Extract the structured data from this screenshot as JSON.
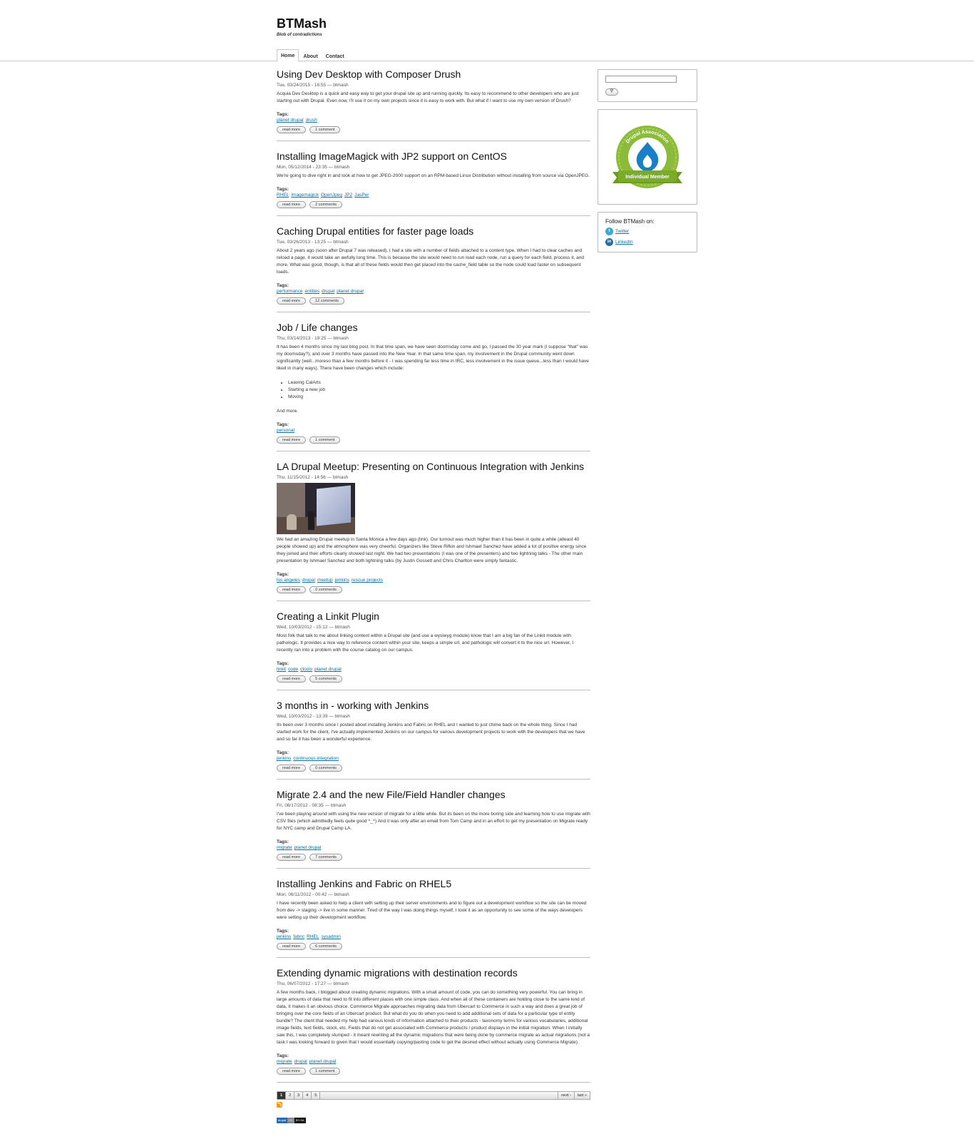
{
  "site": {
    "name": "BTMash",
    "slogan": "Blob of contradictions"
  },
  "tabs": [
    {
      "label": "Home",
      "active": true
    },
    {
      "label": "About"
    },
    {
      "label": "Contact"
    }
  ],
  "nodes": [
    {
      "title": "Using Dev Desktop with Composer Drush",
      "meta": "Tue, 03/24/2015 - 16:55 — btmash",
      "paragraphs": [
        "Acquia Dev Desktop is a quick and easy way to get your drupal site up and running quickly. Its easy to recommend to other developers who are just starting out with Drupal. Even now, I'll use it on my own projects since it is easy to work with. But what if I want to use my own version of Drush?"
      ],
      "tags_label": "Tags:",
      "tags": [
        "planet drupal",
        "drush"
      ],
      "read_more": "read more",
      "comments": "1 comment"
    },
    {
      "title": "Installing ImageMagick with JP2 support on CentOS",
      "meta": "Mon, 05/12/2014 - 23:35 — btmash",
      "paragraphs": [
        "We're going to dive right in and look at how to get JPEG-2000 support on an RPM-based Linux Distribution without installing from source via OpenJPEG."
      ],
      "tags_label": "Tags:",
      "tags": [
        "RHEL",
        "Imagemagick",
        "OpenJpeg",
        "JP2",
        "JasPer"
      ],
      "read_more": "read more",
      "comments": "2 comments"
    },
    {
      "title": "Caching Drupal entities for faster page loads",
      "meta": "Tue, 03/26/2013 - 13:25 — btmash",
      "paragraphs": [
        "About 2 years ago (soon after Drupal 7 was released), I had a site with a number of fields attached to a content type. When I had to clear caches and reload a page, it would take an awfully long time. This is because the site would need to run load each node, run a query for each field, process it, and more. What was good, though, is that all of these fields would then get placed into the cache_field table so the node could load faster on subsequent loads."
      ],
      "tags_label": "Tags:",
      "tags": [
        "performance",
        "entities",
        "drupal",
        "planet drupal"
      ],
      "read_more": "read more",
      "comments": "12 comments"
    },
    {
      "title": "Job / Life changes",
      "meta": "Thu, 03/14/2013 - 19:25 — btmash",
      "paragraphs": [
        "It has been 4 months since my last blog post. In that time span, we have seen doomsday come and go, I passed the 30 year mark (I suppose \"that\" was my doomsday?), and over 3 months have passed into the New Year. In that same time span, my involvement in the Drupal community went down significantly (well...moreso than a few months before it - I was spending far less time in IRC, less involvement in the issue queue...less than I would have liked in many ways). There have been changes which include:"
      ],
      "list": [
        "Leaving CalArts",
        "Starting a new job",
        "Moving"
      ],
      "after": "And more.",
      "tags_label": "Tags:",
      "tags": [
        "personal"
      ],
      "read_more": "read more",
      "comments": "1 comment"
    },
    {
      "title": "LA Drupal Meetup: Presenting on Continuous Integration with Jenkins",
      "meta": "Thu, 11/15/2012 - 14:56 — btmash",
      "has_image": true,
      "paragraphs": [
        "We had an amazing Drupal meetup in Santa Monica a few days ago (link). Our turnout was much higher than it has been in quite a while (atleast 40 people showed up) and the atmosphere was very cheerful. Organizers like Steve Rifkin and Ishmael Sanchez have added a lot of positive energy since they joined and their efforts clearly showed last night. We had two presentations (I was one of the presenters) and two lightning talks - The other main presentation by Ishmael Sanchez and both lightning talks (by Justin Gossett and Chris Charlton were simply fantastic."
      ],
      "tags_label": "Tags:",
      "tags": [
        "los angeles",
        "drupal",
        "meetup",
        "jenkins",
        "rescue projects"
      ],
      "read_more": "read more",
      "comments": "0 comments"
    },
    {
      "title": "Creating a Linkit Plugin",
      "meta": "Wed, 10/03/2012 - 15:12 — btmash",
      "paragraphs": [
        "Most folk that talk to me about linking content within a Drupal site (and use a wysiwyg module) know that I am a big fan of the Linkit module with pathologic. It provides a nice way to reference content within your site, keeps a simple url, and pathologic will convert it to the nice url. However, I recently ran into a problem with the course catalog on our campus."
      ],
      "tags_label": "Tags:",
      "tags": [
        "linkit",
        "code",
        "ctools",
        "planet drupal"
      ],
      "read_more": "read more",
      "comments": "5 comments"
    },
    {
      "title": "3 months in - working with Jenkins",
      "meta": "Wed, 10/03/2012 - 13:39 — btmash",
      "paragraphs": [
        "Its been over 3 months since I posted about installing Jenkins and Fabric on RHEL and I wanted to just chime back on the whole thing. Since I had started work for the client, I've actually implemented Jenkins on our campus for various development projects to work with the developers that we have and so far it has been a wonderful experience."
      ],
      "tags_label": "Tags:",
      "tags": [
        "jenkins",
        "continuous integration"
      ],
      "read_more": "read more",
      "comments": "0 comments"
    },
    {
      "title": "Migrate 2.4 and the new File/Field Handler changes",
      "meta": "Fri, 08/17/2012 - 08:35 — btmash",
      "paragraphs": [
        "I've been playing around with using the new version of migrate for a little while. But its been on the more boring side and learning how to use migrate with CSV files (which admittedly feels quite good ^_^) And it was only after an email from Tom Camp and in an effort to get my presentation on Migrate ready for NYC camp and Drupal Camp LA."
      ],
      "tags_label": "Tags:",
      "tags": [
        "migrate",
        "planet drupal"
      ],
      "read_more": "read more",
      "comments": "7 comments"
    },
    {
      "title": "Installing Jenkins and Fabric on RHEL5",
      "meta": "Mon, 06/11/2012 - 00:42 — btmash",
      "paragraphs": [
        "I have recently been asked to help a client with setting up their server environments and to figure out a development workflow so the site can be moved from dev -> staging -> live in some manner. Tired of the way I was doing things myself, I took it as an opportunity to see some of the ways developers were setting up their development workflow."
      ],
      "tags_label": "Tags:",
      "tags": [
        "jenkins",
        "fabric",
        "RHEL",
        "sysadmin"
      ],
      "read_more": "read more",
      "comments": "6 comments"
    },
    {
      "title": "Extending dynamic migrations with destination records",
      "meta": "Thu, 06/07/2012 - 17:27 — btmash",
      "paragraphs": [
        "A few months back, I blogged about creating dynamic migrations. With a small amount of code, you can do something very powerful. You can bring in large amounts of data that need to fit into different places with one simple class. And when all of these containers are holding close to the same kind of data, it makes it an obvious choice. Commerce Migrate approaches migrating data from Ubercart to Commerce in such a way and does a great job of bringing over the core fields of an Ubercart product. But what do you do when you need to add additional sets of data for a particular type of entity bundle? The client that needed my help had various kinds of information attached to their products - taxonomy terms for various vocabularies, additional image fields, text fields, stock, etc. Fields that do not get associated with Commerce products / product displays in the initial migration. When I initially saw this, I was completely stumped - it meant rewriting all the dynamic migrations that were being done by commerce migrate as actual migrations (not a task I was looking forward to given that I would essentially copying/pasting code to get the desired effect without actually using Commerce Migrate)."
      ],
      "tags_label": "Tags:",
      "tags": [
        "migrate",
        "drupal",
        "planet drupal"
      ],
      "read_more": "read more",
      "comments": "1 comment"
    }
  ],
  "pager": {
    "pages": [
      "1",
      "2",
      "3",
      "4",
      "5"
    ],
    "current": "1",
    "next": "next ›",
    "last": "last »"
  },
  "sidebar": {
    "search_button": "⚲",
    "badge": {
      "top_text": "Drupal Association",
      "band_text": "Individual Member"
    },
    "follow_title": "Follow BTMash on:",
    "social": [
      {
        "label": "Twitter",
        "icon": "t",
        "color": "#3aa8d8"
      },
      {
        "label": "LinkedIn",
        "icon": "in",
        "color": "#1f6fa8"
      }
    ]
  },
  "footer_badges": [
    "drupal",
    "CC",
    "BY-SA"
  ],
  "colors": {
    "link": "#0b6fa4",
    "badge_green": "#7aab2a",
    "badge_blue": "#1a7fc7"
  }
}
